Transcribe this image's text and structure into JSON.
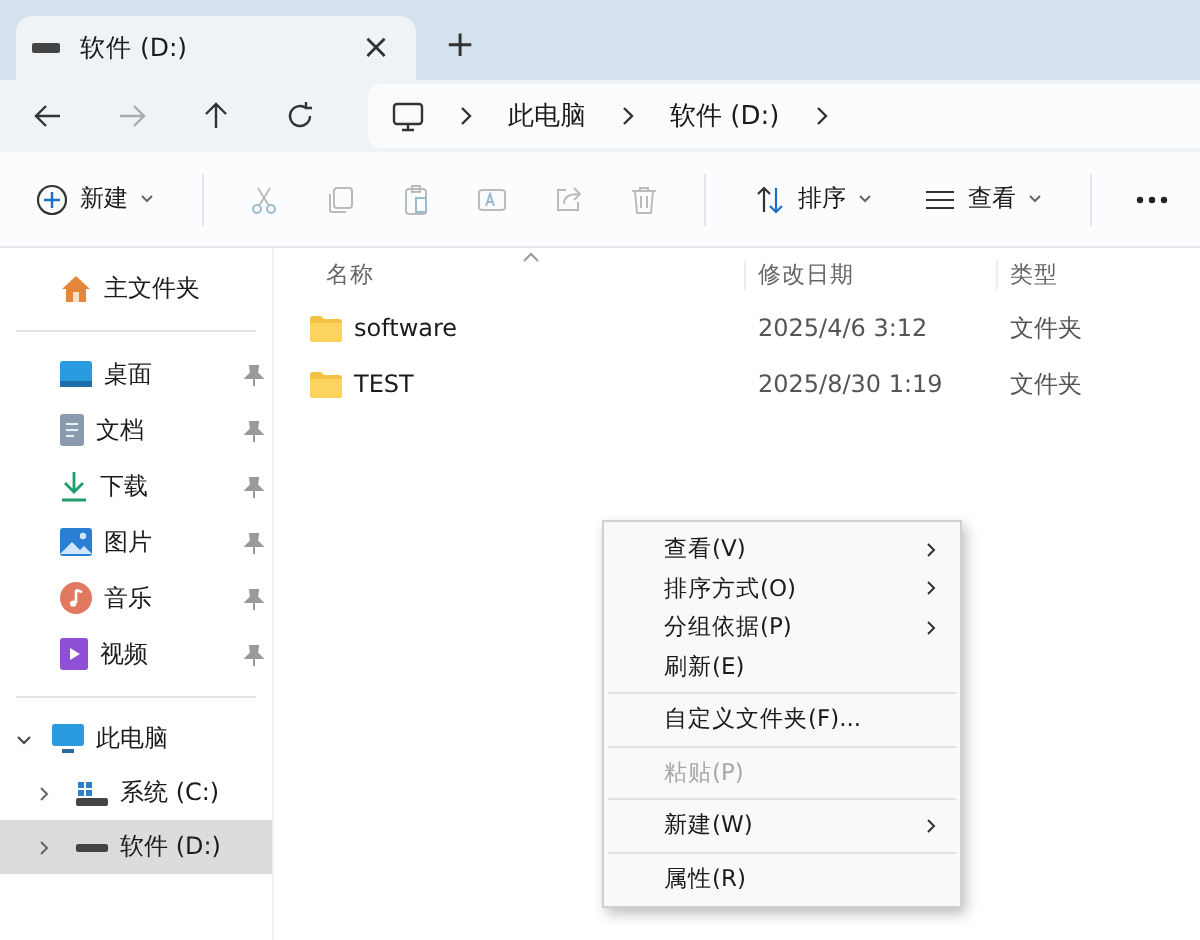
{
  "tabs": [
    {
      "label": "软件 (D:)",
      "selected": true
    }
  ],
  "tab_close": "×",
  "new_tab": "+",
  "breadcrumb": [
    "此电脑",
    "软件 (D:)"
  ],
  "commands": {
    "new": "新建",
    "sort": "排序",
    "view": "查看"
  },
  "sidebar": {
    "home": "主文件夹",
    "quick": [
      {
        "label": "桌面",
        "pinned": true
      },
      {
        "label": "文档",
        "pinned": true
      },
      {
        "label": "下载",
        "pinned": true
      },
      {
        "label": "图片",
        "pinned": true
      },
      {
        "label": "音乐",
        "pinned": true
      },
      {
        "label": "视频",
        "pinned": true
      }
    ],
    "tree": [
      {
        "label": "此电脑",
        "expanded": true,
        "selected": false,
        "children": [
          {
            "label": "系统 (C:)",
            "expanded": false,
            "selected": false
          },
          {
            "label": "软件 (D:)",
            "expanded": false,
            "selected": true
          }
        ]
      }
    ]
  },
  "table": {
    "columns": [
      "名称",
      "修改日期",
      "类型"
    ],
    "rows": [
      {
        "name": "software",
        "modified": "2025/4/6 3:12",
        "type": "文件夹"
      },
      {
        "name": "TEST",
        "modified": "2025/8/30 1:19",
        "type": "文件夹"
      }
    ]
  },
  "context_menu": [
    {
      "kind": "item",
      "label": "查看(V)",
      "submenu": true,
      "disabled": false
    },
    {
      "kind": "item",
      "label": "排序方式(O)",
      "submenu": true,
      "disabled": false
    },
    {
      "kind": "item",
      "label": "分组依据(P)",
      "submenu": true,
      "disabled": false
    },
    {
      "kind": "item",
      "label": "刷新(E)",
      "submenu": false,
      "disabled": false
    },
    {
      "kind": "separator"
    },
    {
      "kind": "item",
      "label": "自定义文件夹(F)...",
      "submenu": false,
      "disabled": false
    },
    {
      "kind": "separator"
    },
    {
      "kind": "item",
      "label": "粘贴(P)",
      "submenu": false,
      "disabled": true
    },
    {
      "kind": "separator"
    },
    {
      "kind": "item",
      "label": "新建(W)",
      "submenu": true,
      "disabled": false
    },
    {
      "kind": "separator"
    },
    {
      "kind": "item",
      "label": "属性(R)",
      "submenu": false,
      "disabled": false
    }
  ]
}
